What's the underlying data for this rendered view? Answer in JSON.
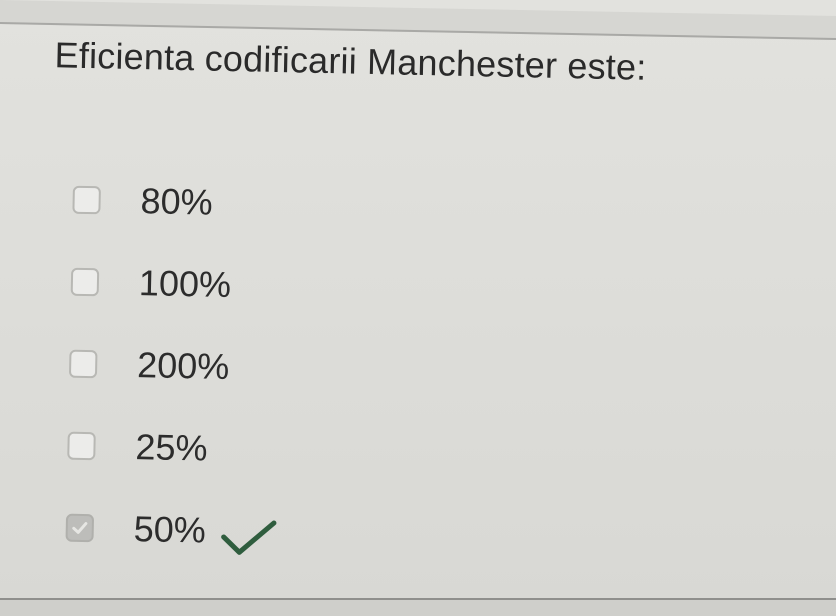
{
  "question": {
    "title": "Eficienta codificarii Manchester este:"
  },
  "options": [
    {
      "label": "80%",
      "checked": false
    },
    {
      "label": "100%",
      "checked": false
    },
    {
      "label": "200%",
      "checked": false
    },
    {
      "label": "25%",
      "checked": false
    },
    {
      "label": "50%",
      "checked": true,
      "correct": true
    }
  ],
  "colors": {
    "correct_mark": "#2f5d3e",
    "text": "#2a2a2a",
    "checkbox_border": "#b8b8b4"
  },
  "icons": {
    "correct": "checkmark-icon"
  }
}
